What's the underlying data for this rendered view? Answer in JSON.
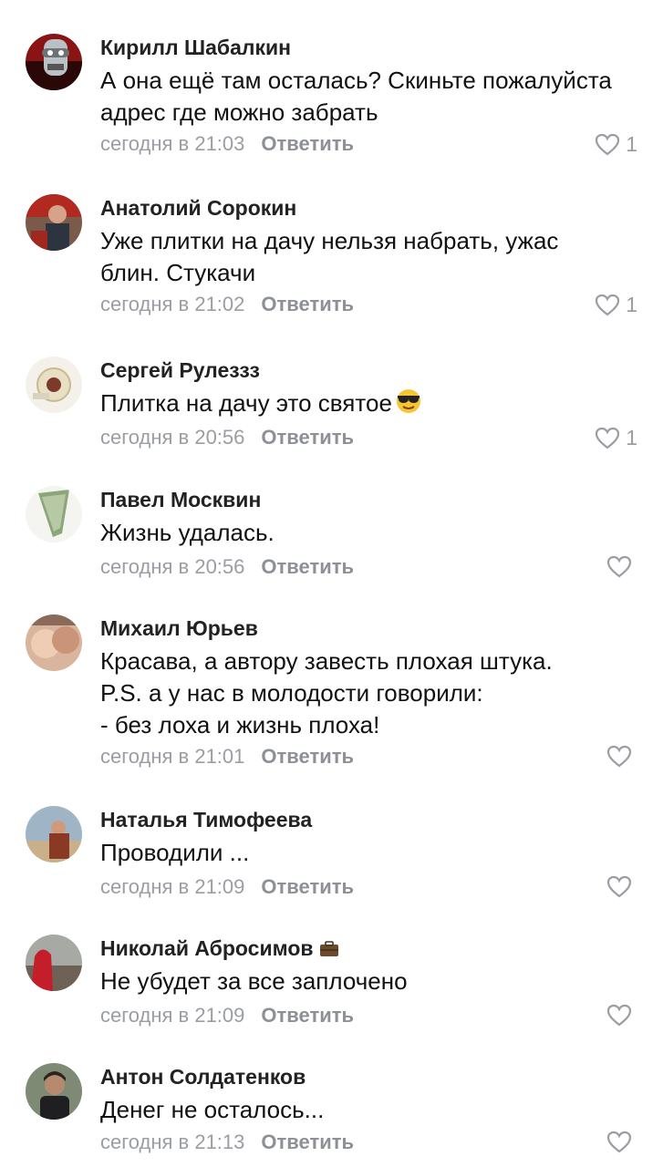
{
  "comments": [
    {
      "name": "Кирилл Шабалкин",
      "lines": [
        "А она ещё там осталась? Скиньте пожалуйста",
        "адрес где можно забрать"
      ],
      "time": "сегодня в 21:03",
      "reply": "Ответить",
      "likes": "1"
    },
    {
      "name": "Анатолий Сорокин",
      "lines": [
        "Уже плитки на дачу нельзя набрать, ужас",
        "блин. Стукачи"
      ],
      "time": "сегодня в 21:02",
      "reply": "Ответить",
      "likes": "1"
    },
    {
      "name": "Сергей Рулеззз",
      "lines": [
        "Плитка на дачу это святое"
      ],
      "time": "сегодня в 20:56",
      "reply": "Ответить",
      "likes": "1"
    },
    {
      "name": "Павел Москвин",
      "lines": [
        "Жизнь удалась."
      ],
      "time": "сегодня в 20:56",
      "reply": "Ответить",
      "likes": ""
    },
    {
      "name": "Михаил Юрьев",
      "lines": [
        "Красава, а автору завесть плохая штука.",
        "P.S. а у нас в молодости говорили:",
        "- без лоха и жизнь плоха!"
      ],
      "time": "сегодня в 21:01",
      "reply": "Ответить",
      "likes": ""
    },
    {
      "name": "Наталья Тимофеева",
      "lines": [
        "Проводили ..."
      ],
      "time": "сегодня в 21:09",
      "reply": "Ответить",
      "likes": ""
    },
    {
      "name": "Николай Абросимов",
      "lines": [
        "Не убудет за все заплочено"
      ],
      "time": "сегодня в 21:09",
      "reply": "Ответить",
      "likes": ""
    },
    {
      "name": "Антон Солдатенков",
      "lines": [
        "Денег не осталось..."
      ],
      "time": "сегодня в 21:13",
      "reply": "Ответить",
      "likes": ""
    }
  ],
  "icons": {
    "like": "heart-outline-icon",
    "emoji": "sunglasses-emoji-icon",
    "badge": "briefcase-icon"
  },
  "colors": {
    "name": "#222222",
    "text": "#111111",
    "meta": "#9a9ea3"
  }
}
